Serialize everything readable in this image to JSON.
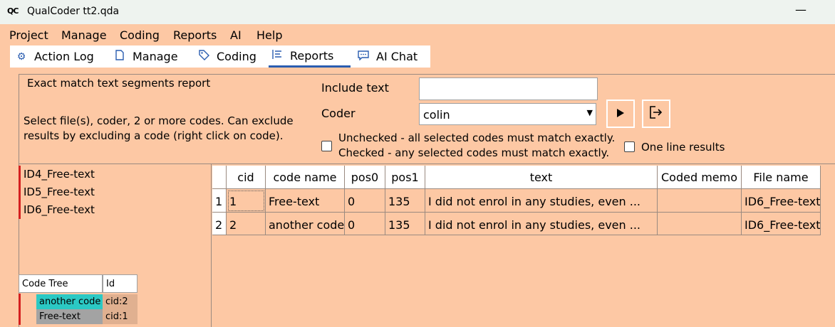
{
  "window": {
    "app_icon": "QC",
    "title": "QualCoder tt2.qda",
    "minimize_glyph": "—"
  },
  "menu": [
    "Project",
    "Manage",
    "Coding",
    "Reports",
    "AI",
    "Help"
  ],
  "tabs": [
    {
      "label": "Action Log",
      "icon": "gear-icon"
    },
    {
      "label": "Manage",
      "icon": "document-icon"
    },
    {
      "label": "Coding",
      "icon": "tag-icon"
    },
    {
      "label": "Reports",
      "icon": "list-icon",
      "active": true
    },
    {
      "label": "AI Chat",
      "icon": "chat-icon"
    }
  ],
  "report": {
    "heading": "Exact match text segments report",
    "instructions_line1": "Select file(s), coder, 2 or more codes. Can exclude",
    "instructions_line2": "results by excluding a code (right click on code).",
    "include_text_label": "Include text",
    "include_text_value": "",
    "coder_label": "Coder",
    "coder_value": "colin",
    "match_checkbox_line1": "Unchecked - all selected codes must match exactly.",
    "match_checkbox_line2": "Checked - any selected codes must match exactly.",
    "match_checked": false,
    "one_line_label": "One line results",
    "one_line_checked": false
  },
  "files": [
    "ID4_Free-text",
    "ID5_Free-text",
    "ID6_Free-text"
  ],
  "code_tree": {
    "headers": [
      "Code Tree",
      "Id"
    ],
    "rows": [
      {
        "name": "another code",
        "id": "cid:2",
        "color": "#2bc9c4"
      },
      {
        "name": "Free-text",
        "id": "cid:1",
        "color": "#a3a3a3"
      }
    ]
  },
  "results": {
    "headers": [
      "cid",
      "code name",
      "pos0",
      "pos1",
      "text",
      "Coded memo",
      "File name"
    ],
    "rows": [
      {
        "num": "1",
        "cells": [
          "1",
          "Free-text",
          "0",
          "135",
          "I did not enrol in any studies, even ...",
          "",
          "ID6_Free-text"
        ]
      },
      {
        "num": "2",
        "cells": [
          "2",
          "another code",
          "0",
          "135",
          "I did not enrol in any studies, even ...",
          "",
          "ID6_Free-text"
        ]
      }
    ]
  }
}
